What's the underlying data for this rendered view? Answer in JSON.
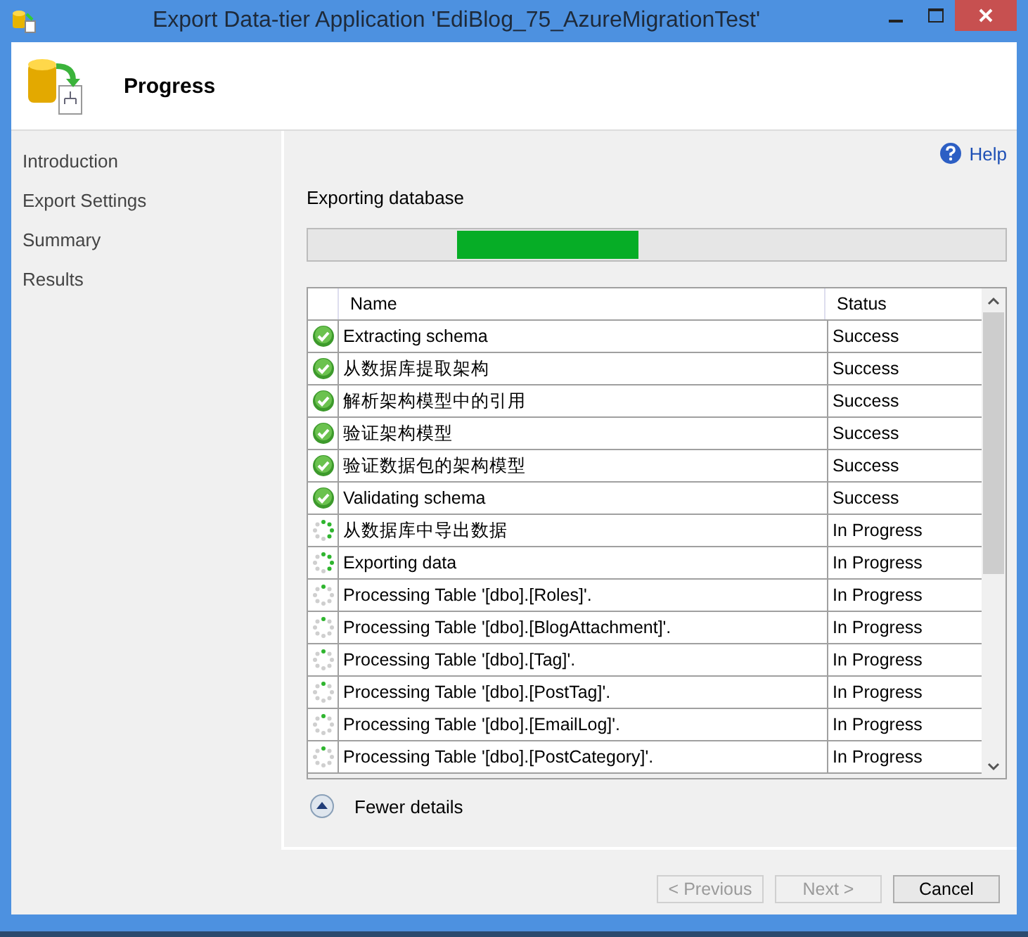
{
  "window": {
    "title": "Export Data-tier Application 'EdiBlog_75_AzureMigrationTest'"
  },
  "header": {
    "title": "Progress"
  },
  "sidebar": {
    "items": [
      {
        "label": "Introduction"
      },
      {
        "label": "Export Settings"
      },
      {
        "label": "Summary"
      },
      {
        "label": "Results"
      }
    ]
  },
  "help": {
    "label": "Help"
  },
  "progress": {
    "label": "Exporting database",
    "level": 0.26
  },
  "table": {
    "columns": [
      "Name",
      "Status"
    ],
    "rows": [
      {
        "kind": "success",
        "name": "Extracting schema",
        "status": "Success"
      },
      {
        "kind": "success",
        "name": "从数据库提取架构",
        "status": "Success"
      },
      {
        "kind": "success",
        "name": "解析架构模型中的引用",
        "status": "Success"
      },
      {
        "kind": "success",
        "name": "验证架构模型",
        "status": "Success"
      },
      {
        "kind": "success",
        "name": "验证数据包的架构模型",
        "status": "Success"
      },
      {
        "kind": "success",
        "name": "Validating schema",
        "status": "Success"
      },
      {
        "kind": "progress",
        "name": "从数据库中导出数据",
        "status": "In Progress"
      },
      {
        "kind": "progress",
        "name": "Exporting data",
        "status": "In Progress"
      },
      {
        "kind": "pending",
        "name": "Processing Table '[dbo].[Roles]'.",
        "status": "In Progress"
      },
      {
        "kind": "pending",
        "name": "Processing Table '[dbo].[BlogAttachment]'.",
        "status": "In Progress"
      },
      {
        "kind": "pending",
        "name": "Processing Table '[dbo].[Tag]'.",
        "status": "In Progress"
      },
      {
        "kind": "pending",
        "name": "Processing Table '[dbo].[PostTag]'.",
        "status": "In Progress"
      },
      {
        "kind": "pending",
        "name": "Processing Table '[dbo].[EmailLog]'.",
        "status": "In Progress"
      },
      {
        "kind": "pending",
        "name": "Processing Table '[dbo].[PostCategory]'.",
        "status": "In Progress"
      }
    ]
  },
  "details_toggle": {
    "label": "Fewer details",
    "expanded": true
  },
  "buttons": [
    {
      "label": "< Previous",
      "disabled": true
    },
    {
      "label": "Next >",
      "disabled": true
    },
    {
      "label": "Cancel",
      "disabled": false
    }
  ]
}
